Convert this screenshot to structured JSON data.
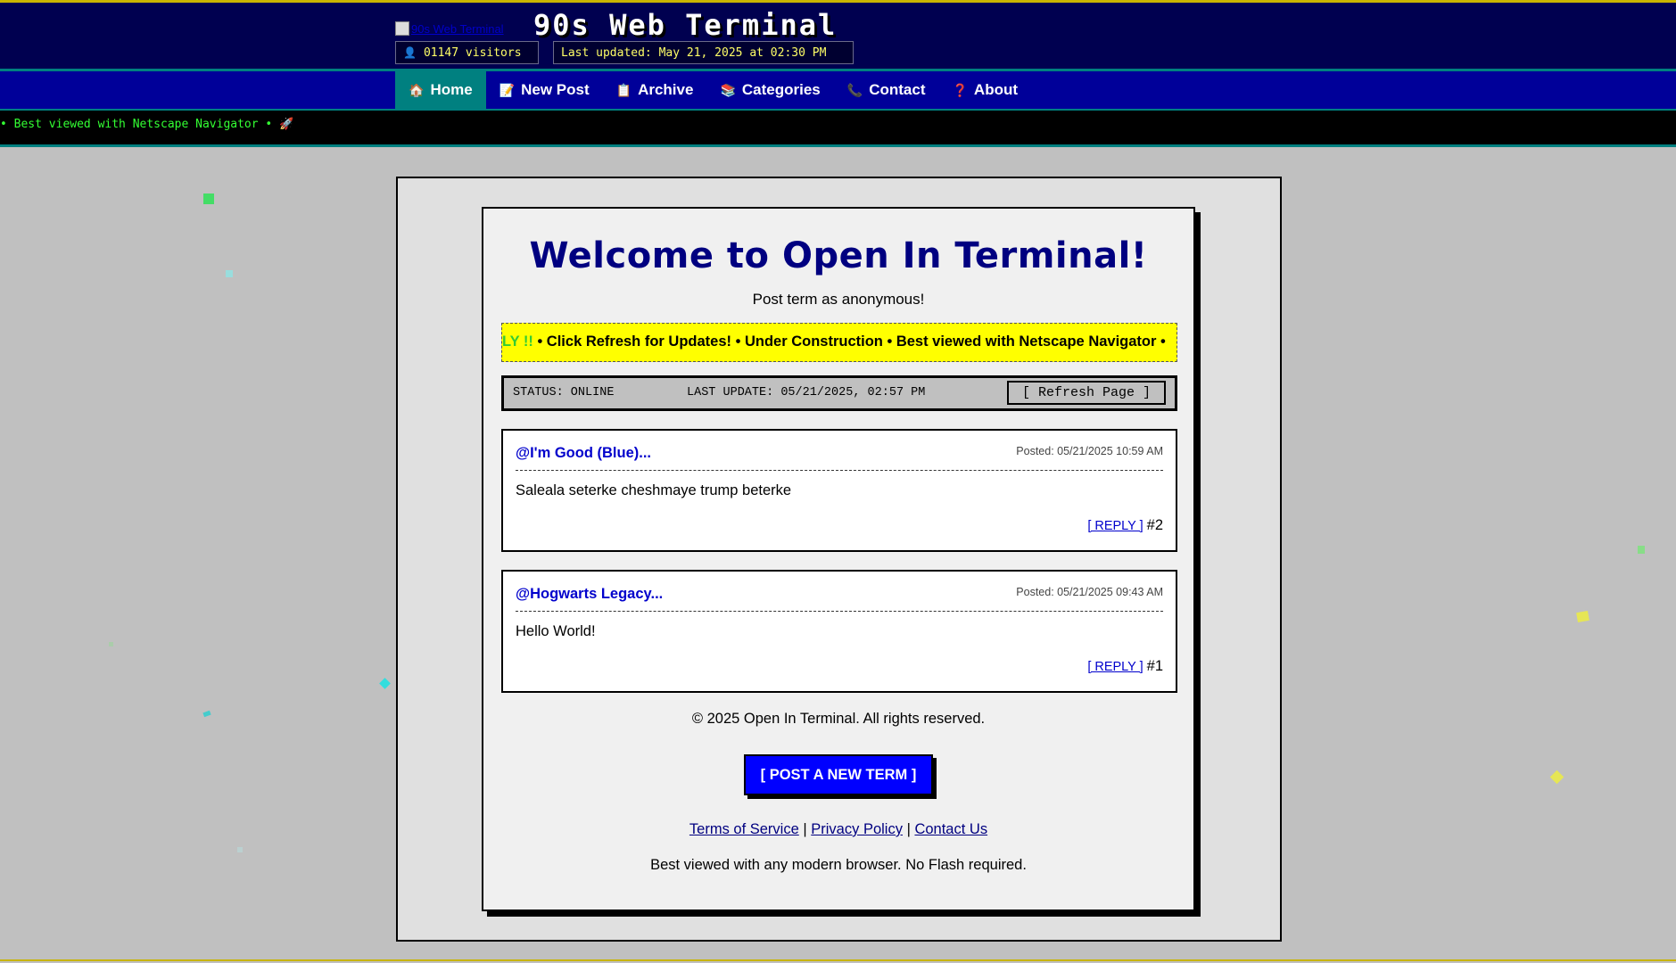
{
  "header": {
    "logo_alt": "90s Web Terminal",
    "title": "90s Web Terminal",
    "visitors": "01147 visitors",
    "last_updated": "Last updated: May 21, 2025 at 02:30 PM"
  },
  "nav": {
    "items": [
      {
        "label": "Home",
        "icon": "house-icon",
        "glyph": "🏠"
      },
      {
        "label": "New Post",
        "icon": "memo-icon",
        "glyph": "📝"
      },
      {
        "label": "Archive",
        "icon": "clipboard-icon",
        "glyph": "📋"
      },
      {
        "label": "Categories",
        "icon": "books-icon",
        "glyph": "📚"
      },
      {
        "label": "Contact",
        "icon": "phone-icon",
        "glyph": "📞"
      },
      {
        "label": "About",
        "icon": "question-icon",
        "glyph": "❓"
      }
    ]
  },
  "ticker": {
    "text": "• Best viewed with Netscape Navigator • 🚀"
  },
  "main": {
    "welcome": "Welcome to Open In Terminal!",
    "subtitle": "Post term as anonymous!",
    "marquee_highlight": "LY !!",
    "marquee_text": " • Click Refresh for Updates! • Under Construction • Best viewed with Netscape Navigator •",
    "status": "STATUS: ONLINE",
    "last_update": "LAST UPDATE: 05/21/2025, 02:57 PM",
    "refresh_label": "[ Refresh Page ]"
  },
  "posts": [
    {
      "author": "@I'm Good (Blue)...",
      "date": "Posted: 05/21/2025 10:59 AM",
      "body": "Saleala seterke cheshmaye trump beterke",
      "reply": "[ REPLY ]",
      "number": "#2"
    },
    {
      "author": "@Hogwarts Legacy...",
      "date": "Posted: 05/21/2025 09:43 AM",
      "body": "Hello World!",
      "reply": "[ REPLY ]",
      "number": "#1"
    }
  ],
  "footer": {
    "copyright": "© 2025 Open In Terminal. All rights reserved.",
    "post_button": "[ POST A NEW TERM ]",
    "terms": "Terms of Service",
    "privacy": "Privacy Policy",
    "contact": "Contact Us",
    "separator": "|",
    "best_viewed": "Best viewed with any modern browser. No Flash required."
  },
  "colors": {
    "header_bg": "#000050",
    "nav_bg": "#000099",
    "nav_active": "#008080",
    "marquee_bg": "#ffff00",
    "button_blue": "#0000ff",
    "title_navy": "#000080"
  }
}
